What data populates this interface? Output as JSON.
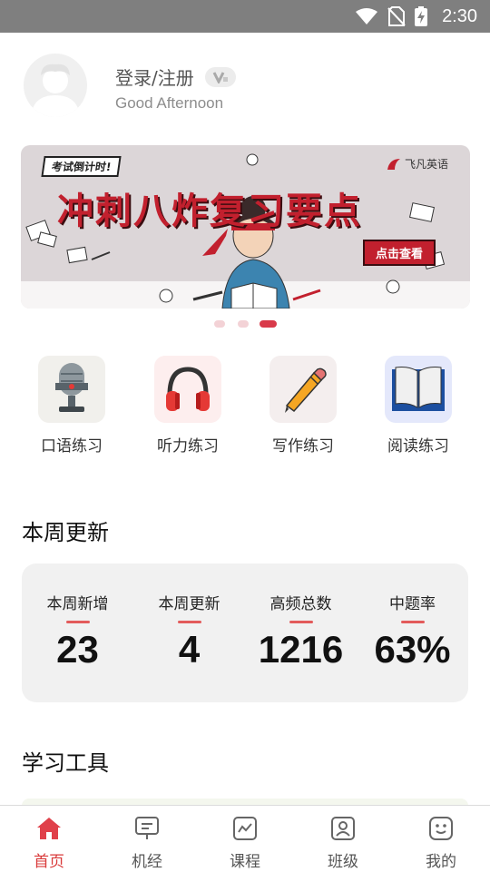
{
  "status_bar": {
    "time": "2:30"
  },
  "profile": {
    "login_label": "登录/注册",
    "greeting": "Good Afternoon"
  },
  "banner": {
    "tag": "考试倒计时!",
    "brand": "飞凡英语",
    "title": "冲刺八炸复习要点",
    "cta": "点击查看",
    "dots_total": 3,
    "active_dot": 3
  },
  "practice": [
    {
      "label": "口语练习",
      "icon": "microphone-icon"
    },
    {
      "label": "听力练习",
      "icon": "headphones-icon"
    },
    {
      "label": "写作练习",
      "icon": "pencil-icon"
    },
    {
      "label": "阅读练习",
      "icon": "book-icon"
    }
  ],
  "weekly": {
    "title": "本周更新",
    "stats": [
      {
        "label": "本周新增",
        "value": "23"
      },
      {
        "label": "本周更新",
        "value": "4"
      },
      {
        "label": "高频总数",
        "value": "1216"
      },
      {
        "label": "中题率",
        "value": "63%"
      }
    ]
  },
  "tools": {
    "title": "学习工具"
  },
  "tabs": [
    {
      "label": "首页",
      "icon": "home-icon",
      "active": true
    },
    {
      "label": "机经",
      "icon": "monitor-icon",
      "active": false
    },
    {
      "label": "课程",
      "icon": "chart-icon",
      "active": false
    },
    {
      "label": "班级",
      "icon": "person-card-icon",
      "active": false
    },
    {
      "label": "我的",
      "icon": "smiley-icon",
      "active": false
    }
  ],
  "colors": {
    "accent": "#d93a3a",
    "status_bar": "#7f7f7f",
    "card_bg": "#f1f1f1"
  }
}
